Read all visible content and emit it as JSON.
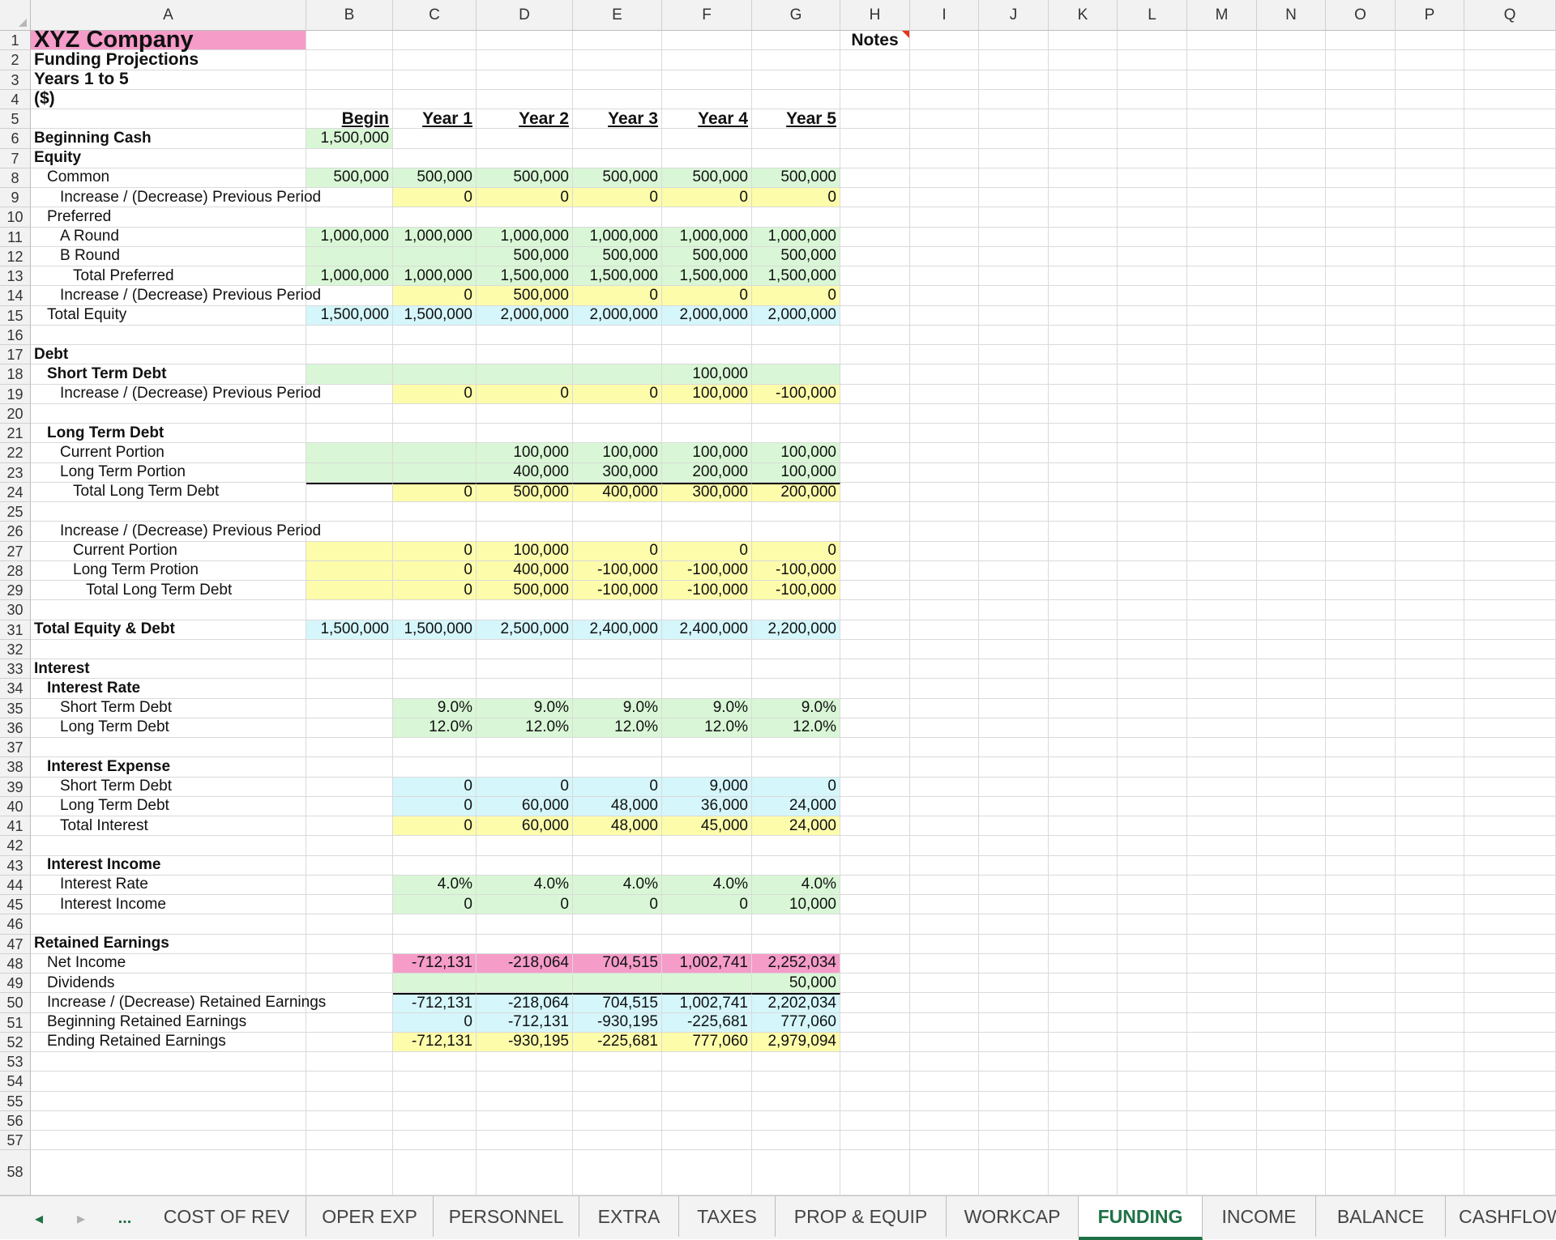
{
  "columns": [
    "A",
    "B",
    "C",
    "D",
    "E",
    "F",
    "G",
    "H",
    "I",
    "J",
    "K",
    "L",
    "M",
    "N",
    "O",
    "P",
    "Q"
  ],
  "header": {
    "company": "XYZ Company",
    "subtitle": "Funding Projections",
    "years": "Years 1 to 5",
    "units": "($)",
    "notes": "Notes",
    "period_labels": [
      "Begin",
      "Year 1",
      "Year 2",
      "Year 3",
      "Year 4",
      "Year 5"
    ]
  },
  "rows": [
    {
      "n": 6,
      "label": "Beginning Cash",
      "indent": 0,
      "bold": true,
      "fills": [
        "green",
        "",
        "",
        "",
        "",
        ""
      ],
      "values": [
        "1,500,000",
        "",
        "",
        "",
        "",
        ""
      ]
    },
    {
      "n": 7,
      "label": "Equity",
      "indent": 0,
      "bold": true,
      "fills": [
        "",
        "",
        "",
        "",
        "",
        ""
      ],
      "values": [
        "",
        "",
        "",
        "",
        "",
        ""
      ]
    },
    {
      "n": 8,
      "label": "Common",
      "indent": 1,
      "bold": false,
      "fills": [
        "green",
        "green",
        "green",
        "green",
        "green",
        "green"
      ],
      "values": [
        "500,000",
        "500,000",
        "500,000",
        "500,000",
        "500,000",
        "500,000"
      ]
    },
    {
      "n": 9,
      "label": "Increase / (Decrease) Previous Period",
      "indent": 2,
      "bold": false,
      "fills": [
        "",
        "yellow",
        "yellow",
        "yellow",
        "yellow",
        "yellow"
      ],
      "values": [
        "",
        "0",
        "0",
        "0",
        "0",
        "0"
      ]
    },
    {
      "n": 10,
      "label": "Preferred",
      "indent": 1,
      "bold": false,
      "fills": [
        "",
        "",
        "",
        "",
        "",
        ""
      ],
      "values": [
        "",
        "",
        "",
        "",
        "",
        ""
      ]
    },
    {
      "n": 11,
      "label": "A Round",
      "indent": 2,
      "bold": false,
      "fills": [
        "green",
        "green",
        "green",
        "green",
        "green",
        "green"
      ],
      "values": [
        "1,000,000",
        "1,000,000",
        "1,000,000",
        "1,000,000",
        "1,000,000",
        "1,000,000"
      ]
    },
    {
      "n": 12,
      "label": "B Round",
      "indent": 2,
      "bold": false,
      "fills": [
        "green",
        "green",
        "green",
        "green",
        "green",
        "green"
      ],
      "values": [
        "",
        "",
        "500,000",
        "500,000",
        "500,000",
        "500,000"
      ]
    },
    {
      "n": 13,
      "label": "Total Preferred",
      "indent": 3,
      "bold": false,
      "fills": [
        "green",
        "green",
        "green",
        "green",
        "green",
        "green"
      ],
      "values": [
        "1,000,000",
        "1,000,000",
        "1,500,000",
        "1,500,000",
        "1,500,000",
        "1,500,000"
      ]
    },
    {
      "n": 14,
      "label": "Increase / (Decrease) Previous Period",
      "indent": 2,
      "bold": false,
      "fills": [
        "",
        "yellow",
        "yellow",
        "yellow",
        "yellow",
        "yellow"
      ],
      "values": [
        "",
        "0",
        "500,000",
        "0",
        "0",
        "0"
      ]
    },
    {
      "n": 15,
      "label": "Total Equity",
      "indent": 1,
      "bold": false,
      "fills": [
        "blue",
        "blue",
        "blue",
        "blue",
        "blue",
        "blue"
      ],
      "values": [
        "1,500,000",
        "1,500,000",
        "2,000,000",
        "2,000,000",
        "2,000,000",
        "2,000,000"
      ]
    },
    {
      "n": 16,
      "label": "",
      "indent": 0,
      "bold": false,
      "fills": [
        "",
        "",
        "",
        "",
        "",
        ""
      ],
      "values": [
        "",
        "",
        "",
        "",
        "",
        ""
      ]
    },
    {
      "n": 17,
      "label": "Debt",
      "indent": 0,
      "bold": true,
      "fills": [
        "",
        "",
        "",
        "",
        "",
        ""
      ],
      "values": [
        "",
        "",
        "",
        "",
        "",
        ""
      ]
    },
    {
      "n": 18,
      "label": "Short Term Debt",
      "indent": 1,
      "bold": true,
      "fills": [
        "green",
        "green",
        "green",
        "green",
        "green",
        "green"
      ],
      "values": [
        "",
        "",
        "",
        "",
        "100,000",
        ""
      ]
    },
    {
      "n": 19,
      "label": "Increase / (Decrease) Previous Period",
      "indent": 2,
      "bold": false,
      "fills": [
        "",
        "yellow",
        "yellow",
        "yellow",
        "yellow",
        "yellow"
      ],
      "values": [
        "",
        "0",
        "0",
        "0",
        "100,000",
        "-100,000"
      ]
    },
    {
      "n": 20,
      "label": "",
      "indent": 0,
      "bold": false,
      "fills": [
        "",
        "",
        "",
        "",
        "",
        ""
      ],
      "values": [
        "",
        "",
        "",
        "",
        "",
        ""
      ]
    },
    {
      "n": 21,
      "label": "Long Term Debt",
      "indent": 1,
      "bold": true,
      "fills": [
        "",
        "",
        "",
        "",
        "",
        ""
      ],
      "values": [
        "",
        "",
        "",
        "",
        "",
        ""
      ]
    },
    {
      "n": 22,
      "label": "Current Portion",
      "indent": 2,
      "bold": false,
      "fills": [
        "green",
        "green",
        "green",
        "green",
        "green",
        "green"
      ],
      "values": [
        "",
        "",
        "100,000",
        "100,000",
        "100,000",
        "100,000"
      ]
    },
    {
      "n": 23,
      "label": "Long Term Portion",
      "indent": 2,
      "bold": false,
      "fills": [
        "green",
        "green",
        "green",
        "green",
        "green",
        "green"
      ],
      "values": [
        "",
        "",
        "400,000",
        "300,000",
        "200,000",
        "100,000"
      ]
    },
    {
      "n": 24,
      "label": "Total Long Term Debt",
      "indent": 3,
      "bold": false,
      "fills": [
        "",
        "yellow",
        "yellow",
        "yellow",
        "yellow",
        "yellow"
      ],
      "values": [
        "",
        "0",
        "500,000",
        "400,000",
        "300,000",
        "200,000"
      ],
      "topline": true
    },
    {
      "n": 25,
      "label": "",
      "indent": 0,
      "bold": false,
      "fills": [
        "",
        "",
        "",
        "",
        "",
        ""
      ],
      "values": [
        "",
        "",
        "",
        "",
        "",
        ""
      ]
    },
    {
      "n": 26,
      "label": "Increase / (Decrease) Previous Period",
      "indent": 2,
      "bold": false,
      "fills": [
        "",
        "",
        "",
        "",
        "",
        ""
      ],
      "values": [
        "",
        "",
        "",
        "",
        "",
        ""
      ]
    },
    {
      "n": 27,
      "label": "Current Portion",
      "indent": 3,
      "bold": false,
      "fills": [
        "yellow",
        "yellow",
        "yellow",
        "yellow",
        "yellow",
        "yellow"
      ],
      "values": [
        "",
        "0",
        "100,000",
        "0",
        "0",
        "0"
      ]
    },
    {
      "n": 28,
      "label": "Long Term Protion",
      "indent": 3,
      "bold": false,
      "fills": [
        "yellow",
        "yellow",
        "yellow",
        "yellow",
        "yellow",
        "yellow"
      ],
      "values": [
        "",
        "0",
        "400,000",
        "-100,000",
        "-100,000",
        "-100,000"
      ]
    },
    {
      "n": 29,
      "label": "Total Long Term Debt",
      "indent": 4,
      "bold": false,
      "fills": [
        "yellow",
        "yellow",
        "yellow",
        "yellow",
        "yellow",
        "yellow"
      ],
      "values": [
        "",
        "0",
        "500,000",
        "-100,000",
        "-100,000",
        "-100,000"
      ]
    },
    {
      "n": 30,
      "label": "",
      "indent": 0,
      "bold": false,
      "fills": [
        "",
        "",
        "",
        "",
        "",
        ""
      ],
      "values": [
        "",
        "",
        "",
        "",
        "",
        ""
      ]
    },
    {
      "n": 31,
      "label": "Total Equity & Debt",
      "indent": 0,
      "bold": true,
      "fills": [
        "blue",
        "blue",
        "blue",
        "blue",
        "blue",
        "blue"
      ],
      "values": [
        "1,500,000",
        "1,500,000",
        "2,500,000",
        "2,400,000",
        "2,400,000",
        "2,200,000"
      ]
    },
    {
      "n": 32,
      "label": "",
      "indent": 0,
      "bold": false,
      "fills": [
        "",
        "",
        "",
        "",
        "",
        ""
      ],
      "values": [
        "",
        "",
        "",
        "",
        "",
        ""
      ]
    },
    {
      "n": 33,
      "label": "Interest",
      "indent": 0,
      "bold": true,
      "fills": [
        "",
        "",
        "",
        "",
        "",
        ""
      ],
      "values": [
        "",
        "",
        "",
        "",
        "",
        ""
      ]
    },
    {
      "n": 34,
      "label": "Interest Rate",
      "indent": 1,
      "bold": true,
      "fills": [
        "",
        "",
        "",
        "",
        "",
        ""
      ],
      "values": [
        "",
        "",
        "",
        "",
        "",
        ""
      ]
    },
    {
      "n": 35,
      "label": "Short Term Debt",
      "indent": 2,
      "bold": false,
      "fills": [
        "",
        "green",
        "green",
        "green",
        "green",
        "green"
      ],
      "values": [
        "",
        "9.0%",
        "9.0%",
        "9.0%",
        "9.0%",
        "9.0%"
      ]
    },
    {
      "n": 36,
      "label": "Long Term Debt",
      "indent": 2,
      "bold": false,
      "fills": [
        "",
        "green",
        "green",
        "green",
        "green",
        "green"
      ],
      "values": [
        "",
        "12.0%",
        "12.0%",
        "12.0%",
        "12.0%",
        "12.0%"
      ]
    },
    {
      "n": 37,
      "label": "",
      "indent": 0,
      "bold": false,
      "fills": [
        "",
        "",
        "",
        "",
        "",
        ""
      ],
      "values": [
        "",
        "",
        "",
        "",
        "",
        ""
      ]
    },
    {
      "n": 38,
      "label": "Interest Expense",
      "indent": 1,
      "bold": true,
      "fills": [
        "",
        "",
        "",
        "",
        "",
        ""
      ],
      "values": [
        "",
        "",
        "",
        "",
        "",
        ""
      ]
    },
    {
      "n": 39,
      "label": "Short Term Debt",
      "indent": 2,
      "bold": false,
      "fills": [
        "",
        "blue",
        "blue",
        "blue",
        "blue",
        "blue"
      ],
      "values": [
        "",
        "0",
        "0",
        "0",
        "9,000",
        "0"
      ]
    },
    {
      "n": 40,
      "label": "Long Term Debt",
      "indent": 2,
      "bold": false,
      "fills": [
        "",
        "blue",
        "blue",
        "blue",
        "blue",
        "blue"
      ],
      "values": [
        "",
        "0",
        "60,000",
        "48,000",
        "36,000",
        "24,000"
      ]
    },
    {
      "n": 41,
      "label": "Total Interest",
      "indent": 2,
      "bold": false,
      "fills": [
        "",
        "yellow",
        "yellow",
        "yellow",
        "yellow",
        "yellow"
      ],
      "values": [
        "",
        "0",
        "60,000",
        "48,000",
        "45,000",
        "24,000"
      ]
    },
    {
      "n": 42,
      "label": "",
      "indent": 0,
      "bold": false,
      "fills": [
        "",
        "",
        "",
        "",
        "",
        ""
      ],
      "values": [
        "",
        "",
        "",
        "",
        "",
        ""
      ]
    },
    {
      "n": 43,
      "label": "Interest Income",
      "indent": 1,
      "bold": true,
      "fills": [
        "",
        "",
        "",
        "",
        "",
        ""
      ],
      "values": [
        "",
        "",
        "",
        "",
        "",
        ""
      ]
    },
    {
      "n": 44,
      "label": "Interest Rate",
      "indent": 2,
      "bold": false,
      "fills": [
        "",
        "green",
        "green",
        "green",
        "green",
        "green"
      ],
      "values": [
        "",
        "4.0%",
        "4.0%",
        "4.0%",
        "4.0%",
        "4.0%"
      ]
    },
    {
      "n": 45,
      "label": "Interest Income",
      "indent": 2,
      "bold": false,
      "fills": [
        "",
        "green",
        "green",
        "green",
        "green",
        "green"
      ],
      "values": [
        "",
        "0",
        "0",
        "0",
        "0",
        "10,000"
      ]
    },
    {
      "n": 46,
      "label": "",
      "indent": 0,
      "bold": false,
      "fills": [
        "",
        "",
        "",
        "",
        "",
        ""
      ],
      "values": [
        "",
        "",
        "",
        "",
        "",
        ""
      ]
    },
    {
      "n": 47,
      "label": "Retained Earnings",
      "indent": 0,
      "bold": true,
      "fills": [
        "",
        "",
        "",
        "",
        "",
        ""
      ],
      "values": [
        "",
        "",
        "",
        "",
        "",
        ""
      ]
    },
    {
      "n": 48,
      "label": "Net Income",
      "indent": 1,
      "bold": false,
      "fills": [
        "",
        "pink",
        "pink",
        "pink",
        "pink",
        "pink"
      ],
      "values": [
        "",
        "-712,131",
        "-218,064",
        "704,515",
        "1,002,741",
        "2,252,034"
      ]
    },
    {
      "n": 49,
      "label": "Dividends",
      "indent": 1,
      "bold": false,
      "fills": [
        "",
        "green",
        "green",
        "green",
        "green",
        "green"
      ],
      "values": [
        "",
        "",
        "",
        "",
        "",
        "50,000"
      ]
    },
    {
      "n": 50,
      "label": "Increase / (Decrease) Retained Earnings",
      "indent": 1,
      "bold": false,
      "fills": [
        "",
        "blue",
        "blue",
        "blue",
        "blue",
        "blue"
      ],
      "values": [
        "",
        "-712,131",
        "-218,064",
        "704,515",
        "1,002,741",
        "2,202,034"
      ],
      "topline_from": 1
    },
    {
      "n": 51,
      "label": "Beginning Retained Earnings",
      "indent": 1,
      "bold": false,
      "fills": [
        "",
        "blue",
        "blue",
        "blue",
        "blue",
        "blue"
      ],
      "values": [
        "",
        "0",
        "-712,131",
        "-930,195",
        "-225,681",
        "777,060"
      ]
    },
    {
      "n": 52,
      "label": "Ending Retained Earnings",
      "indent": 1,
      "bold": false,
      "fills": [
        "",
        "yellow",
        "yellow",
        "yellow",
        "yellow",
        "yellow"
      ],
      "values": [
        "",
        "-712,131",
        "-930,195",
        "-225,681",
        "777,060",
        "2,979,094"
      ]
    }
  ],
  "empty_rows": [
    53,
    54,
    55,
    56,
    57,
    58
  ],
  "tabs": {
    "nav_prev": "◂",
    "nav_next": "▸",
    "more": "...",
    "items": [
      "COST OF REV",
      "OPER EXP",
      "PERSONNEL",
      "EXTRA",
      "TAXES",
      "PROP & EQUIP",
      "WORKCAP",
      "FUNDING",
      "INCOME",
      "BALANCE",
      "CASHFLOW"
    ],
    "active": "FUNDING"
  },
  "colors": {
    "green": "#d9f7d6",
    "yellow": "#fdfcab",
    "blue": "#d5f6fb",
    "pink": "#f59cc9",
    "accent": "#1f7145"
  }
}
